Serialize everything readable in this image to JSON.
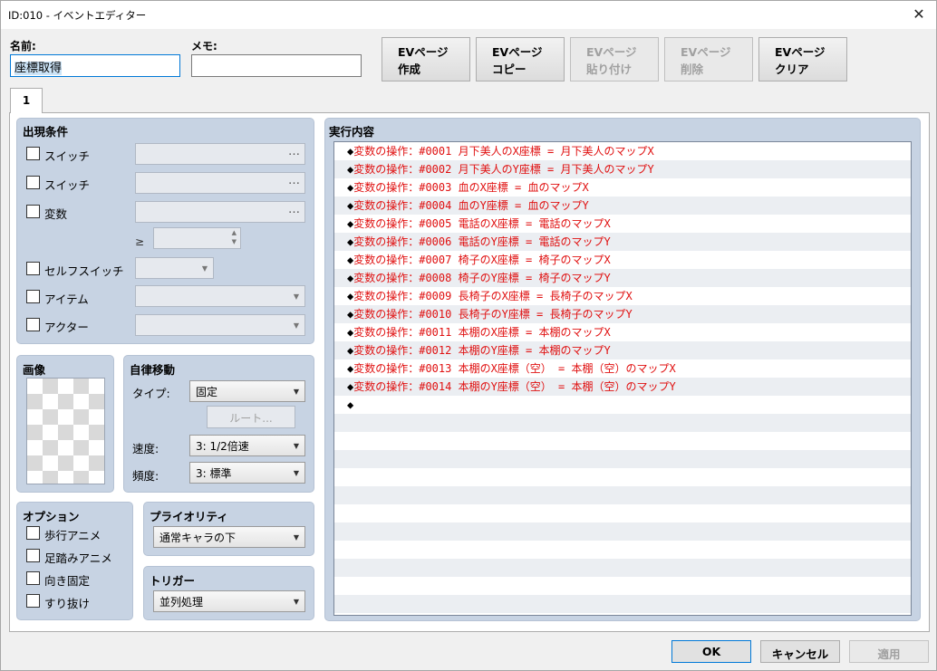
{
  "window": {
    "title": "ID:010 - イベントエディター",
    "close_glyph": "✕"
  },
  "name_label": "名前:",
  "name_value": "座標取得",
  "memo_label": "メモ:",
  "memo_value": "",
  "ev_buttons": [
    {
      "line1": "EVページ",
      "line2": "作成"
    },
    {
      "line1": "EVページ",
      "line2": "コピー"
    },
    {
      "line1": "EVページ",
      "line2": "貼り付け"
    },
    {
      "line1": "EVページ",
      "line2": "削除"
    },
    {
      "line1": "EVページ",
      "line2": "クリア"
    }
  ],
  "page_tab": "1",
  "conditions": {
    "title": "出現条件",
    "switch1": "スイッチ",
    "switch2": "スイッチ",
    "variable": "変数",
    "ge_symbol": "≥",
    "self_switch": "セルフスイッチ",
    "item": "アイテム",
    "actor": "アクター",
    "dots": "…"
  },
  "image": {
    "title": "画像"
  },
  "movement": {
    "title": "自律移動",
    "type_label": "タイプ:",
    "type_value": "固定",
    "route_button": "ルート...",
    "speed_label": "速度:",
    "speed_value": "3: 1/2倍速",
    "freq_label": "頻度:",
    "freq_value": "3: 標準"
  },
  "options": {
    "title": "オプション",
    "walk_anim": "歩行アニメ",
    "step_anim": "足踏みアニメ",
    "dir_fix": "向き固定",
    "through": "すり抜け"
  },
  "priority": {
    "title": "プライオリティ",
    "value": "通常キャラの下"
  },
  "trigger": {
    "title": "トリガー",
    "value": "並列処理"
  },
  "contents": {
    "title": "実行内容",
    "commands": [
      "◆変数の操作：#0001 月下美人のX座標 = 月下美人のマップX",
      "◆変数の操作：#0002 月下美人のY座標 = 月下美人のマップY",
      "◆変数の操作：#0003 血のX座標 = 血のマップX",
      "◆変数の操作：#0004 血のY座標 = 血のマップY",
      "◆変数の操作：#0005 電話のX座標 = 電話のマップX",
      "◆変数の操作：#0006 電話のY座標 = 電話のマップY",
      "◆変数の操作：#0007 椅子のX座標 = 椅子のマップX",
      "◆変数の操作：#0008 椅子のY座標 = 椅子のマップY",
      "◆変数の操作：#0009 長椅子のX座標 = 長椅子のマップX",
      "◆変数の操作：#0010 長椅子のY座標 = 長椅子のマップY",
      "◆変数の操作：#0011 本棚のX座標 = 本棚のマップX",
      "◆変数の操作：#0012 本棚のY座標 = 本棚のマップY",
      "◆変数の操作：#0013 本棚のX座標（空） = 本棚（空）のマップX",
      "◆変数の操作：#0014 本棚のY座標（空） = 本棚（空）のマップY",
      "◆"
    ]
  },
  "footer": {
    "ok": "OK",
    "cancel": "キャンセル",
    "apply": "適用"
  }
}
